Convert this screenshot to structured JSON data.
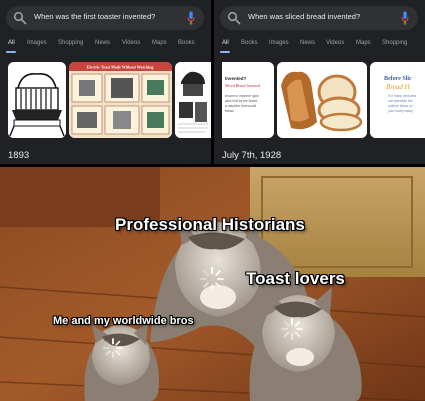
{
  "left_screen": {
    "query": "When was the first toaster invented?",
    "tabs": [
      "All",
      "Images",
      "Shopping",
      "News",
      "Videos",
      "Maps",
      "Books"
    ],
    "active_tab": "All",
    "image_caption": "Electric Toast Made Without Watching",
    "answer": "1893"
  },
  "right_screen": {
    "query": "When was sliced bread invented?",
    "tabs": [
      "All",
      "Books",
      "Images",
      "News",
      "Videos",
      "Maps",
      "Shopping"
    ],
    "active_tab": "All",
    "card1_lines": [
      "Invented?",
      "Sliced Bread Invented",
      "known to improve upon",
      "slice loaf by the bread",
      "a machine that would",
      "bread"
    ],
    "card3_title": "Before Slic",
    "card3_script": "Bread H",
    "card3_lines": [
      "For many centuries",
      "not resemble the",
      "uniform slices yo",
      "your lovely today"
    ],
    "answer": "July 7th, 1928"
  },
  "meme": {
    "labels": {
      "professional_historians": "Professional Historians",
      "toast_lovers": "Toast lovers",
      "me_and_bros": "Me and my worldwide bros"
    }
  },
  "colors": {
    "screen_bg": "#202124",
    "search_bg": "#303134",
    "text": "#e8eaed",
    "muted": "#9aa0a6",
    "accent": "#8ab4f8"
  }
}
